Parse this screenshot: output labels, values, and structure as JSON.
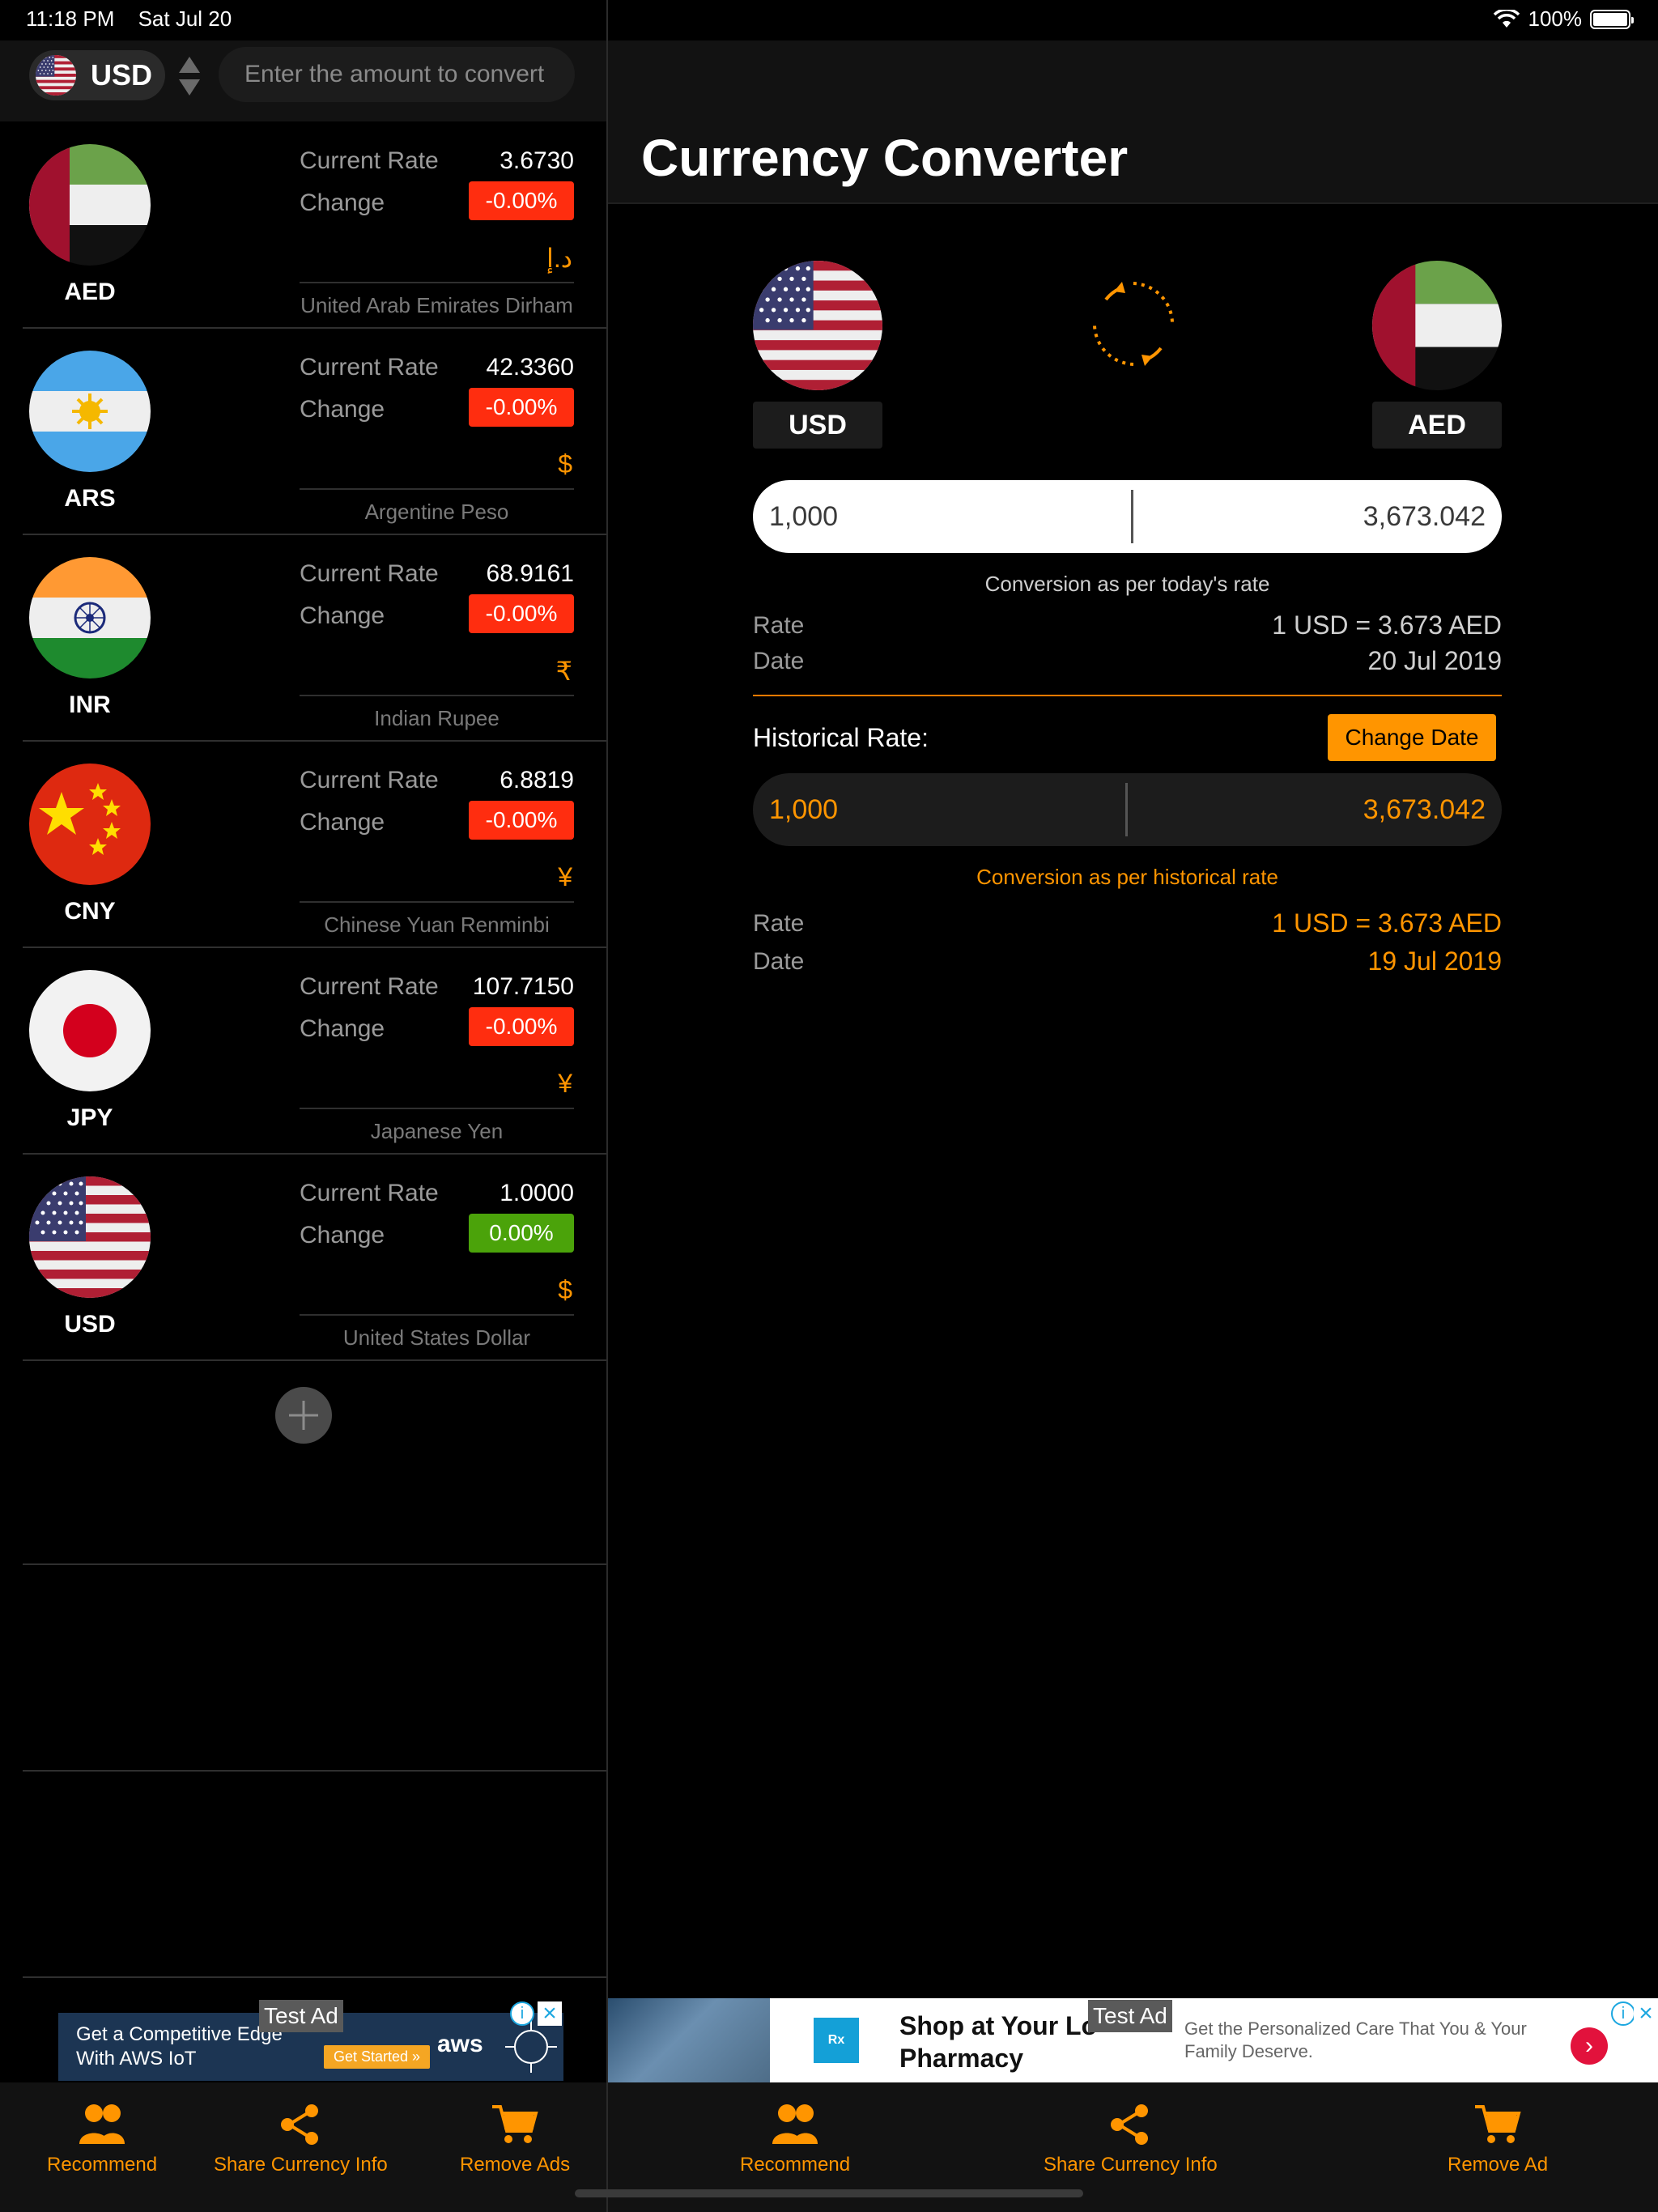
{
  "status_bar": {
    "time": "11:18 PM",
    "date": "Sat Jul 20",
    "battery": "100%"
  },
  "base": {
    "code": "USD",
    "amount_placeholder": "Enter the amount to convert"
  },
  "labels": {
    "current_rate": "Current Rate",
    "change": "Change"
  },
  "currencies": [
    {
      "code": "AED",
      "rate": "3.6730",
      "change": "-0.00%",
      "change_status": "negative",
      "symbol": "د.إ",
      "name": "United Arab Emirates Dirham",
      "flag": "uae-flag-icon"
    },
    {
      "code": "ARS",
      "rate": "42.3360",
      "change": "-0.00%",
      "change_status": "negative",
      "symbol": "$",
      "name": "Argentine Peso",
      "flag": "argentina-flag-icon"
    },
    {
      "code": "INR",
      "rate": "68.9161",
      "change": "-0.00%",
      "change_status": "negative",
      "symbol": "₹",
      "name": "Indian Rupee",
      "flag": "india-flag-icon"
    },
    {
      "code": "CNY",
      "rate": "6.8819",
      "change": "-0.00%",
      "change_status": "negative",
      "symbol": "¥",
      "name": "Chinese Yuan Renminbi",
      "flag": "china-flag-icon"
    },
    {
      "code": "JPY",
      "rate": "107.7150",
      "change": "-0.00%",
      "change_status": "negative",
      "symbol": "¥",
      "name": "Japanese Yen",
      "flag": "japan-flag-icon"
    },
    {
      "code": "USD",
      "rate": "1.0000",
      "change": "0.00%",
      "change_status": "positive",
      "symbol": "$",
      "name": "United States Dollar",
      "flag": "usa-flag-icon"
    }
  ],
  "ads": {
    "tag": "Test Ad",
    "left": {
      "text_line1": "Get a Competitive Edge",
      "text_line2": "With AWS IoT",
      "cta": "Get Started »",
      "brand": "aws"
    },
    "right": {
      "headline_line1": "Shop at Your Lo",
      "headline_line2": "Pharmacy",
      "body": "Get the Personalized Care That You & Your Family Deserve."
    }
  },
  "toolbar": {
    "recommend": "Recommend",
    "share": "Share Currency Info",
    "remove_ads_left": "Remove Ads",
    "remove_ad_right": "Remove Ad"
  },
  "converter": {
    "title": "Currency Converter",
    "from_code": "USD",
    "to_code": "AED",
    "today": {
      "amount": "1,000",
      "result": "3,673.042",
      "caption": "Conversion as per today's rate",
      "rate_label": "Rate",
      "rate_value": "1 USD = 3.673 AED",
      "date_label": "Date",
      "date_value": "20 Jul 2019"
    },
    "historical": {
      "title": "Historical Rate:",
      "change_date": "Change Date",
      "amount": "1,000",
      "result": "3,673.042",
      "caption": "Conversion as per historical rate",
      "rate_label": "Rate",
      "rate_value": "1 USD = 3.673 AED",
      "date_label": "Date",
      "date_value": "19 Jul 2019"
    }
  },
  "colors": {
    "accent": "#ff9500",
    "negative": "#ff2d0f",
    "positive": "#4ba30a",
    "background": "#000000"
  }
}
